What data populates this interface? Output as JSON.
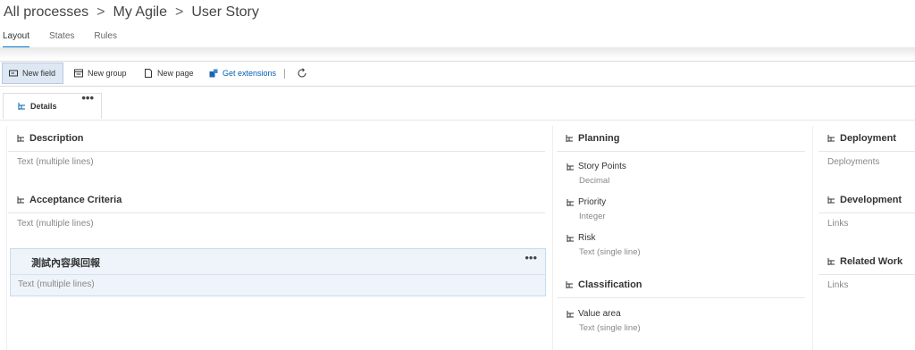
{
  "breadcrumb": {
    "root": "All processes",
    "process": "My Agile",
    "item": "User Story",
    "separator": ">"
  },
  "tabs": [
    {
      "label": "Layout",
      "active": true
    },
    {
      "label": "States"
    },
    {
      "label": "Rules"
    }
  ],
  "toolbar": {
    "new_field": "New field",
    "new_group": "New group",
    "new_page": "New page",
    "get_extensions": "Get extensions"
  },
  "page_tab": {
    "label": "Details",
    "more": "•••"
  },
  "column1": {
    "groups": [
      {
        "title": "Description",
        "control": "Text (multiple lines)"
      },
      {
        "title": "Acceptance Criteria",
        "control": "Text (multiple lines)"
      }
    ],
    "selected_group": {
      "title": "測試內容與回報",
      "control": "Text (multiple lines)",
      "more": "•••"
    }
  },
  "column2": {
    "planning": {
      "title": "Planning",
      "fields": [
        {
          "label": "Story Points",
          "type": "Decimal"
        },
        {
          "label": "Priority",
          "type": "Integer"
        },
        {
          "label": "Risk",
          "type": "Text (single line)"
        }
      ]
    },
    "classification": {
      "title": "Classification",
      "fields": [
        {
          "label": "Value area",
          "type": "Text (single line)"
        }
      ]
    }
  },
  "column3": {
    "groups": [
      {
        "title": "Deployment",
        "control": "Deployments"
      },
      {
        "title": "Development",
        "control": "Links"
      },
      {
        "title": "Related Work",
        "control": "Links"
      }
    ]
  },
  "colors": {
    "accent": "#0078d4",
    "selected_bg": "#eef4fa",
    "toolbar_active_bg": "#dde8f4"
  }
}
